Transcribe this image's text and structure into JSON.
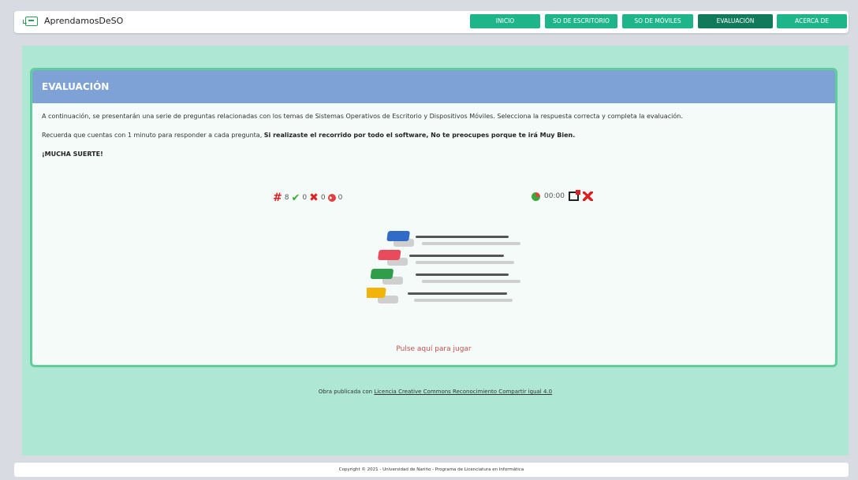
{
  "header": {
    "brand": "AprendamosDeSO",
    "nav": [
      "INICIO",
      "SO DE ESCRITORIO",
      "SO DE MÓVILES",
      "EVALUACIÓN",
      "ACERCA DE"
    ],
    "active": "EVALUACIÓN"
  },
  "card": {
    "title": "EVALUACIÓN",
    "intro": "A continuación, se presentarán una serie de preguntas relacionadas con los temas de Sistemas Operativos de Escritorio y Dispositivos Móviles. Selecciona la respuesta correcta y completa la evaluación.",
    "note_prefix": "Recuerda que cuentas con 1 minuto para responder a cada pregunta, ",
    "note_bold": "Si realizaste el recorrido por todo el software, No te preocupes porque te irá Muy Bien.",
    "luck": "¡MUCHA SUERTE!",
    "stats": {
      "questions": "8",
      "correct": "0",
      "wrong": "0",
      "skipped": "0"
    },
    "timer": "00:00",
    "play": "Pulse aquí para jugar"
  },
  "license": {
    "prefix": "Obra publicada con ",
    "link": "Licencia Creative Commons Reconocimiento Compartir igual 4.0"
  },
  "footer": "Copyright © 2021 - Universidad de Nariño - Programa de Licenciatura en Informática",
  "colors": {
    "nav": "#1fb58a",
    "nav_active": "#117a5b",
    "header": "#7ea2d5",
    "page_bg": "#aee7d3",
    "card_border": "#5fcd9c"
  },
  "icons": [
    "hash-icon",
    "check-icon",
    "cross-icon",
    "skip-icon",
    "pie-timer-icon",
    "exit-icon",
    "fullscreen-icon"
  ]
}
